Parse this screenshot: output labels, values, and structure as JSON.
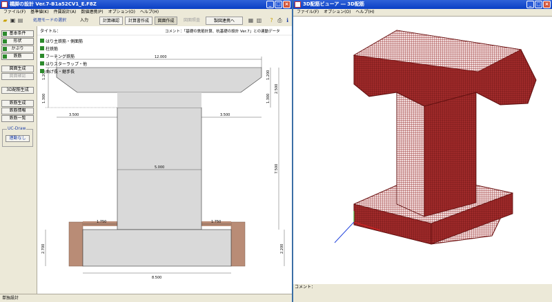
{
  "left_window": {
    "title": "橋脚の設計 Ver.7-B1a52CV1_E.F8Z",
    "menu": [
      "ファイル(F)",
      "基準値(K)",
      "件属設計(A)",
      "数値連携(P)",
      "オプション(O)",
      "ヘルプ(H)"
    ],
    "toolbar": {
      "mode_select": "処理モードの選択",
      "input": "入力",
      "calc_confirm": "計算確認",
      "report": "計算書作成",
      "drawing": "図面作成",
      "drawing_check": "図面照査",
      "linkage": "製図連携へ"
    },
    "sidebar": {
      "checks": [
        "基本条件",
        "形状",
        "かぶり",
        "鉄筋"
      ],
      "draw_gen": "図面生成",
      "draw_confirm": "図面確認",
      "rebar3d": "3D配筋生成",
      "rebar_gen": "鉄筋生成",
      "rebar_info": "鉄筋情報",
      "rebar_list": "鉄筋一覧",
      "ucdraw_group": "UC-Draw",
      "ucdraw_btn": "連動なし"
    },
    "drawing": {
      "title_label": "タイトル：",
      "comment": "コメント：「基礎の鉄筋計算、杭基礎の設計 Ver.7」との連動データ",
      "layers": [
        "はり主鉄筋・側面筋",
        "柱鉄筋",
        "フーチング鉄筋",
        "はりスターラップ・他",
        "曲げ長・継手長"
      ],
      "dims": {
        "top_width": "12.000",
        "beam_h1": "1.200",
        "beam_h2": "1.300",
        "beam_total": "2.500",
        "beam_right1": "1.200",
        "beam_right2": "1.300",
        "overhang_left": "3.500",
        "overhang_right": "3.500",
        "column_width": "5.000",
        "column_height": "7.500",
        "footing_left": "1.750",
        "footing_right": "1.750",
        "footing_width": "8.500",
        "footing_height_left": "2.700",
        "footing_height_right": "2.200"
      }
    },
    "status": "単独設計"
  },
  "right_window": {
    "title": "3D配筋ビューア ― 3D配筋",
    "menu": [
      "ファイル(F)",
      "オプション(O)",
      "ヘルプ(H)"
    ],
    "status_label": "コメント："
  },
  "colors": {
    "rebar": "#8b1a1a",
    "concrete": "#d9d9d9",
    "soil": "#b98c76",
    "titlebar": "#0a3fc4"
  }
}
